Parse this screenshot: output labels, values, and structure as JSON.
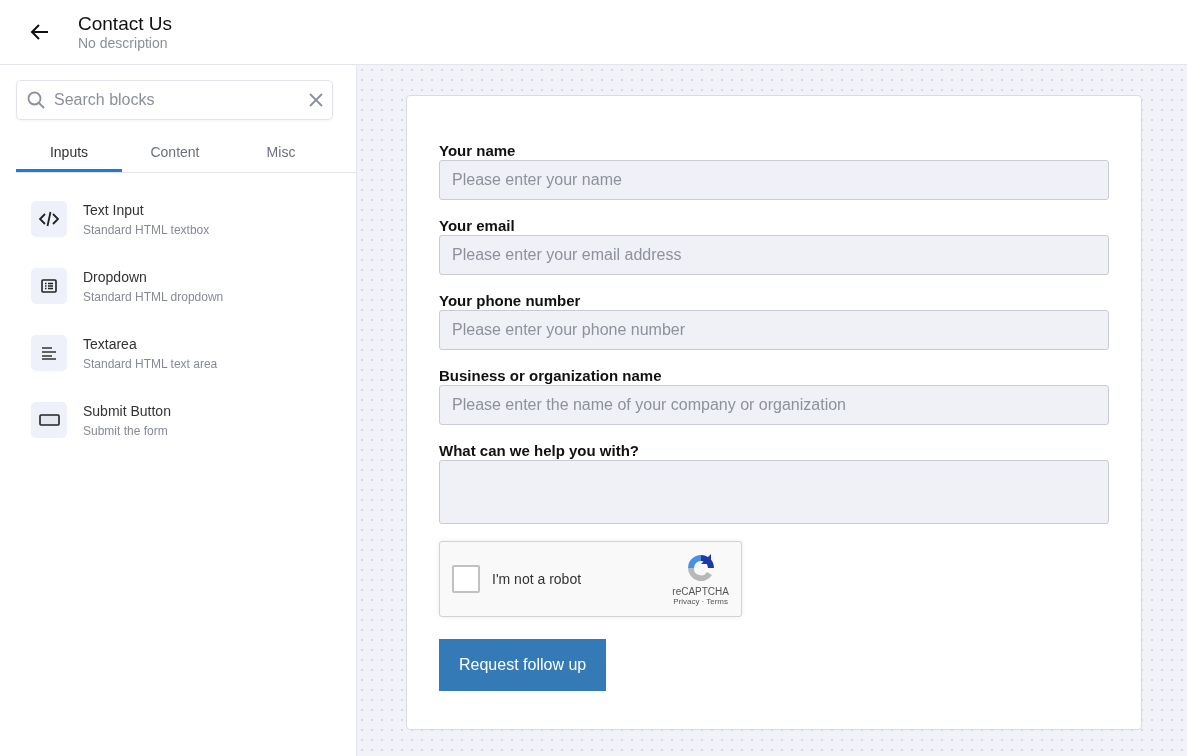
{
  "header": {
    "title": "Contact Us",
    "subtitle": "No description"
  },
  "sidebar": {
    "search": {
      "placeholder": "Search blocks"
    },
    "tabs": [
      {
        "label": "Inputs",
        "selected": true
      },
      {
        "label": "Content",
        "selected": false
      },
      {
        "label": "Misc",
        "selected": false
      }
    ],
    "blocks": [
      {
        "kind": "code",
        "title": "Text Input",
        "description": "Standard HTML textbox"
      },
      {
        "kind": "list",
        "title": "Dropdown",
        "description": "Standard HTML dropdown"
      },
      {
        "kind": "lines",
        "title": "Textarea",
        "description": "Standard HTML text area"
      },
      {
        "kind": "button",
        "title": "Submit Button",
        "description": "Submit the form"
      }
    ]
  },
  "form": {
    "fields": [
      {
        "kind": "input",
        "label": "Your name",
        "placeholder": "Please enter your name"
      },
      {
        "kind": "input",
        "label": "Your email",
        "placeholder": "Please enter your email address"
      },
      {
        "kind": "input",
        "label": "Your phone number",
        "placeholder": "Please enter your phone number"
      },
      {
        "kind": "input",
        "label": "Business or organization name",
        "placeholder": "Please enter the name of your company or organization"
      },
      {
        "kind": "textarea",
        "label": "What can we help you with?"
      }
    ],
    "captcha": {
      "label": "I'm not a robot",
      "checked": false,
      "brand": "reCAPTCHA",
      "privacy": "Privacy",
      "separator": "·",
      "terms": "Terms"
    },
    "submit": "Request follow up"
  }
}
